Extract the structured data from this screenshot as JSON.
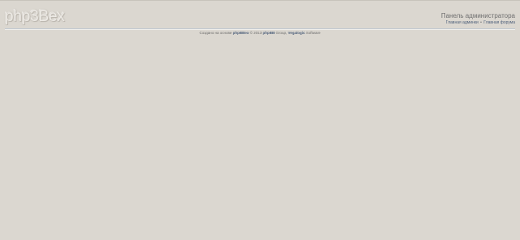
{
  "header": {
    "logo_text": "php3Bex",
    "admin_title": "Панель администратора",
    "links": {
      "admin_home": "Главная админки",
      "separator": "•",
      "forum_home": "Главная форума"
    }
  },
  "footer": {
    "prefix": "Создано на основе",
    "brand": "phpBBex",
    "middle": "© 2013",
    "phpbb": "phpBB",
    "group": "Group,",
    "vegalogic": "Vegalogic",
    "software": "Software"
  },
  "colors": {
    "background": "#dbd7d0",
    "link": "#4d5f7a",
    "title": "#6f6f6f",
    "divider": "#bfc7d0"
  }
}
